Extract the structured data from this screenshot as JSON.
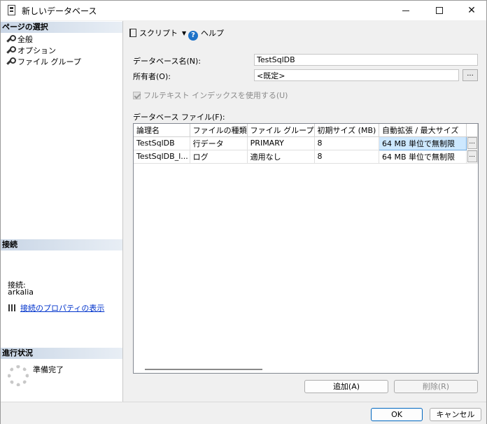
{
  "window": {
    "title": "新しいデータベース"
  },
  "left_panel": {
    "pages_header": "ページの選択",
    "pages": [
      {
        "label": "全般",
        "icon": "wrench-icon"
      },
      {
        "label": "オプション",
        "icon": "wrench-icon"
      },
      {
        "label": "ファイル グループ",
        "icon": "wrench-icon"
      }
    ],
    "connection_header": "接続",
    "connection_label": "接続:",
    "connection_value": "arkalia",
    "connection_link": "接続のプロパティの表示",
    "progress_header": "進行状況",
    "progress_status": "準備完了"
  },
  "toolbar": {
    "script_label": "スクリプト",
    "help_label": "ヘルプ"
  },
  "form": {
    "db_name_label": "データベース名(N):",
    "db_name_value": "TestSqlDB",
    "owner_label": "所有者(O):",
    "owner_value": "<既定>",
    "owner_button": "...",
    "fulltext_label": "フルテキスト インデックスを使用する(U)",
    "files_label": "データベース ファイル(F):"
  },
  "grid": {
    "columns": [
      "論理名",
      "ファイルの種類",
      "ファイル グループ",
      "初期サイズ (MB)",
      "自動拡張 / 最大サイズ"
    ],
    "rows": [
      {
        "name": "TestSqlDB",
        "type": "行データ",
        "filegroup": "PRIMARY",
        "size": "8",
        "autogrowth": "64 MB 単位で無制限",
        "button": "..."
      },
      {
        "name": "TestSqlDB_l...",
        "type": "ログ",
        "filegroup": "適用なし",
        "size": "8",
        "autogrowth": "64 MB 単位で無制限",
        "button": "..."
      }
    ]
  },
  "buttons": {
    "add": "追加(A)",
    "remove": "削除(R)",
    "ok": "OK",
    "cancel": "キャンセル"
  }
}
